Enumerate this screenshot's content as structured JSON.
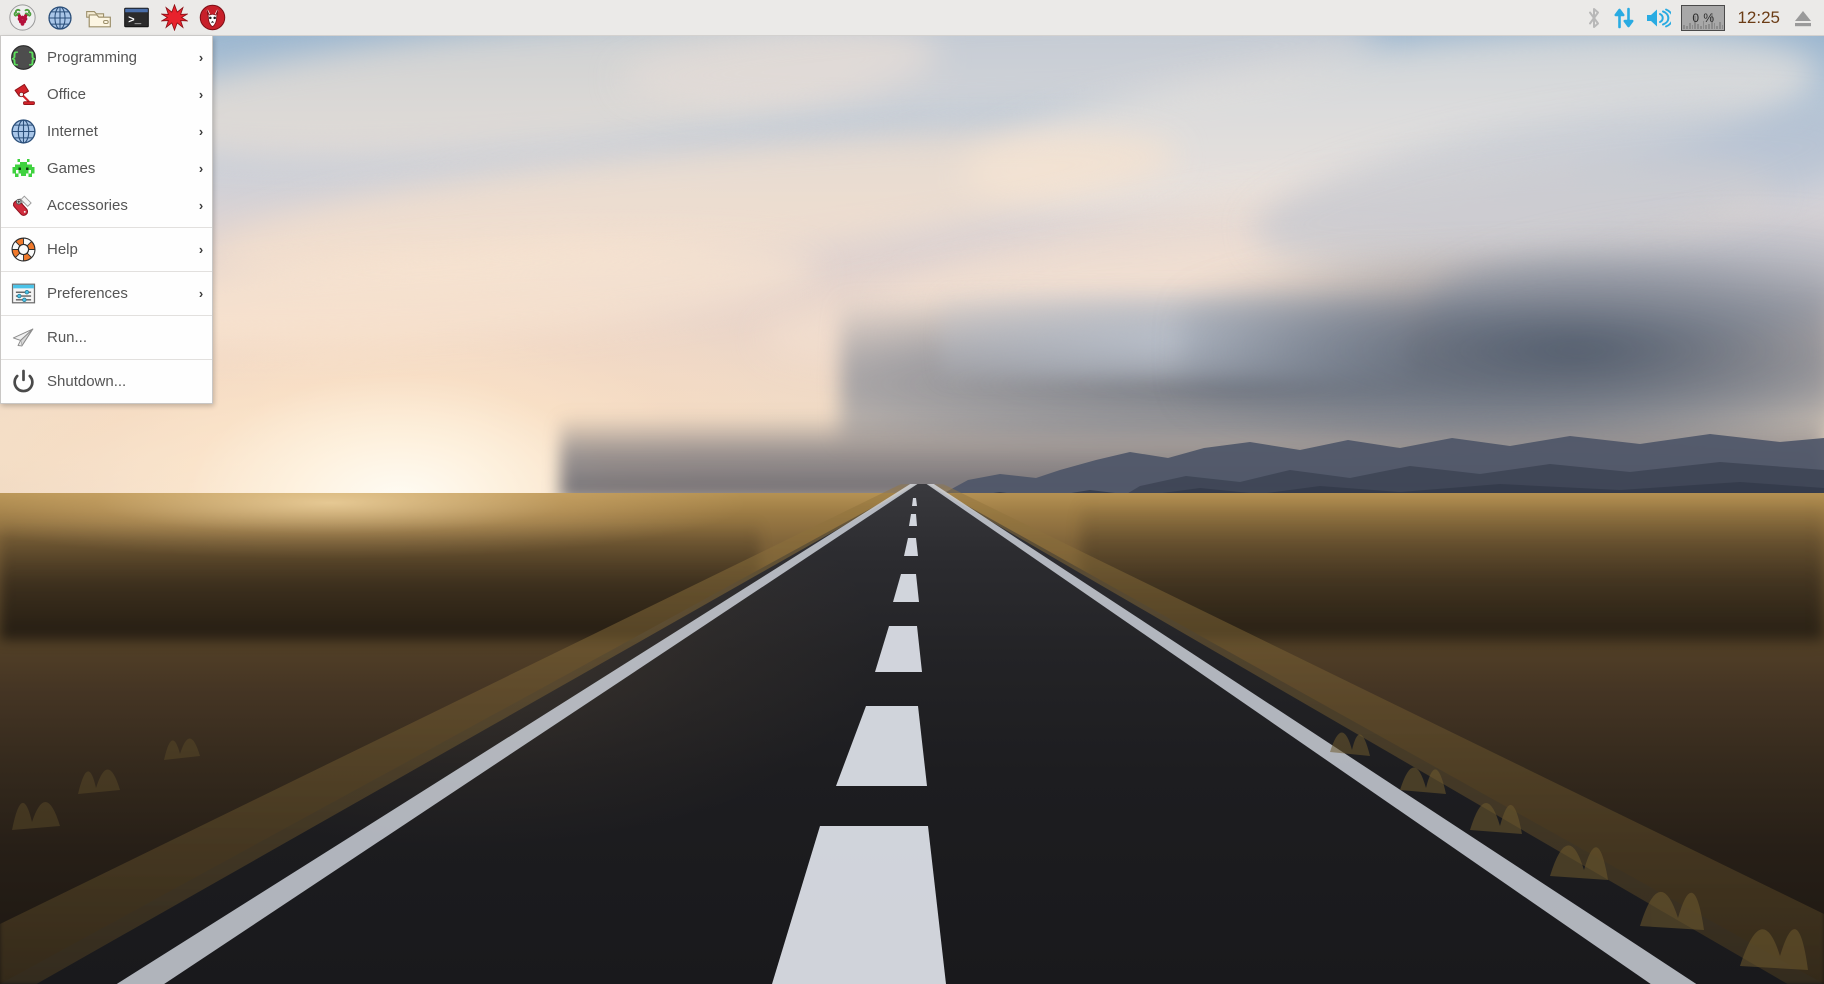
{
  "desktop": {
    "wallpaper_name": "road-sunset-iceland",
    "wallpaper_description": "Straight asphalt road through flat golden plains at sunset with mountains on the horizon",
    "colors": {
      "taskbar_bg": "#ebeae8",
      "menu_bg": "#fefefe",
      "menu_text": "#555555",
      "accent_blue": "#29abe2",
      "clock_text": "#6b3c15",
      "road_dark": "#1d1d20",
      "land_gold": "#9d7c45",
      "sky_blue": "#93b0cd",
      "sun_glow": "#fff7e9"
    }
  },
  "taskbar": {
    "launchers": [
      {
        "name": "raspberry-menu",
        "icon": "raspberry-icon",
        "label": "Menu"
      },
      {
        "name": "web-browser",
        "icon": "globe-icon",
        "label": "Web Browser"
      },
      {
        "name": "file-manager",
        "icon": "folder-icon",
        "label": "File Manager"
      },
      {
        "name": "terminal",
        "icon": "terminal-icon",
        "label": "Terminal"
      },
      {
        "name": "mathematica",
        "icon": "starburst-icon",
        "label": "Mathematica"
      },
      {
        "name": "wolfram",
        "icon": "fox-head-icon",
        "label": "Wolfram"
      }
    ],
    "tray": [
      {
        "name": "bluetooth",
        "icon": "bluetooth-icon",
        "label": "Bluetooth"
      },
      {
        "name": "network",
        "icon": "network-updown-icon",
        "label": "Network"
      },
      {
        "name": "volume",
        "icon": "speaker-icon",
        "label": "Volume"
      }
    ],
    "cpu_monitor": {
      "label": "0 %",
      "value": 0,
      "unit": "%"
    },
    "clock": "12:25",
    "eject": {
      "name": "eject",
      "icon": "eject-icon",
      "label": "Eject"
    }
  },
  "start_menu": {
    "items": [
      {
        "label": "Programming",
        "icon": "braces-icon",
        "has_submenu": true,
        "separator_after": false
      },
      {
        "label": "Office",
        "icon": "desk-lamp-icon",
        "has_submenu": true,
        "separator_after": false
      },
      {
        "label": "Internet",
        "icon": "globe-icon",
        "has_submenu": true,
        "separator_after": false
      },
      {
        "label": "Games",
        "icon": "space-invader-icon",
        "has_submenu": true,
        "separator_after": false
      },
      {
        "label": "Accessories",
        "icon": "pocket-knife-icon",
        "has_submenu": true,
        "separator_after": true
      },
      {
        "label": "Help",
        "icon": "lifebuoy-icon",
        "has_submenu": true,
        "separator_after": true
      },
      {
        "label": "Preferences",
        "icon": "sliders-window-icon",
        "has_submenu": true,
        "separator_after": true
      },
      {
        "label": "Run...",
        "icon": "paper-plane-icon",
        "has_submenu": false,
        "separator_after": true
      },
      {
        "label": "Shutdown...",
        "icon": "power-icon",
        "has_submenu": false,
        "separator_after": false
      }
    ],
    "submenu_arrow": "›"
  }
}
